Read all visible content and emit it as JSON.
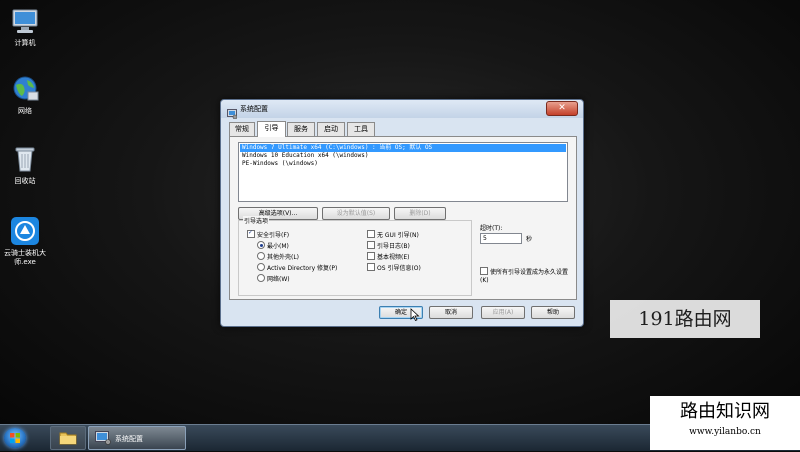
{
  "desktop": {
    "icons": [
      {
        "label": "计算机",
        "icon": "computer-icon"
      },
      {
        "label": "网络",
        "icon": "network-globe-icon"
      },
      {
        "label": "回收站",
        "icon": "recycle-bin-icon"
      },
      {
        "label": "云骑士装机大师.exe",
        "icon": "yunqishi-app-icon"
      }
    ]
  },
  "dialog": {
    "title": "系统配置",
    "close_label": "✕",
    "tabs": [
      "常规",
      "引导",
      "服务",
      "启动",
      "工具"
    ],
    "active_tab": "引导",
    "os_list": [
      {
        "label": "Windows 7 Ultimate x64 (C:\\windows) : 当前 OS; 默认 OS",
        "selected": true
      },
      {
        "label": "Windows 10 Education x64 (\\windows)",
        "selected": false
      },
      {
        "label": "PE-Windows (\\windows)",
        "selected": false
      }
    ],
    "buttons": {
      "advanced": "高级选项(V)...",
      "set_default": "设为默认值(S)",
      "delete": "删除(D)"
    },
    "boot_options": {
      "title": "引导选项",
      "safe_boot": "安全引导(F)",
      "minimal": "最小(M)",
      "alternate_shell": "其他外壳(L)",
      "ad_repair": "Active Directory 修复(P)",
      "network": "网络(W)",
      "no_gui": "无 GUI 引导(N)",
      "boot_log": "引导日志(B)",
      "base_video": "基本视频(E)",
      "os_info": "OS 引导信息(O)"
    },
    "timeout": {
      "label": "超时(T):",
      "value": "5",
      "unit": "秒"
    },
    "make_permanent": "使所有引导设置成为永久设置(K)",
    "footer": {
      "ok": "确定",
      "cancel": "取消",
      "apply": "应用(A)",
      "help": "帮助"
    }
  },
  "taskbar": {
    "start_icon": "windows-orb-icon",
    "folder_icon": "explorer-folder-icon",
    "running_label": "系统配置"
  },
  "watermarks": {
    "primary": "191路由网",
    "secondary_title": "路由知识网",
    "secondary_url": "www.yilanbo.cn"
  }
}
